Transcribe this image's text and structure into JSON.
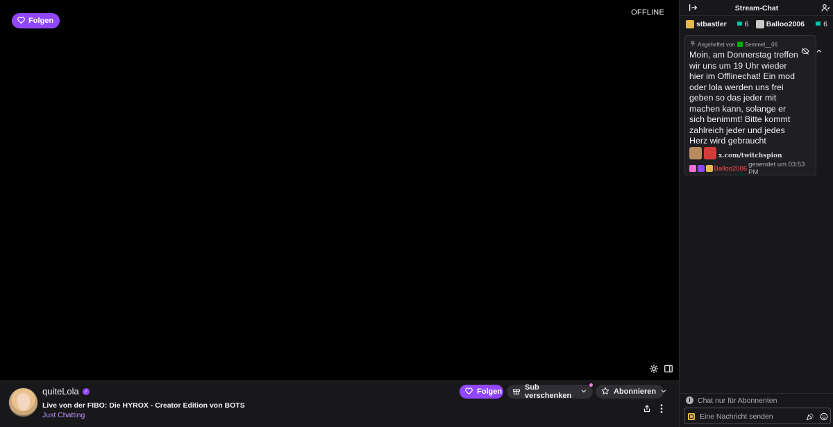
{
  "player": {
    "follow_label": "Folgen",
    "status": "OFFLINE"
  },
  "channel": {
    "name": "quiteLola",
    "title": "Live von der FIBO: Die HYROX - Creator Edition von BOTS",
    "category": "Just Chatting"
  },
  "actions": {
    "follow_label": "Folgen",
    "gift_sub_label": "Sub verschenken",
    "subscribe_label": "Abonnieren"
  },
  "chat": {
    "title": "Stream-Chat",
    "gifters": [
      {
        "name": "stbastler",
        "count": "6"
      },
      {
        "name": "Balloo2006",
        "count": "6"
      }
    ],
    "pinned": {
      "pinned_by_prefix": "Angeheftet von",
      "pinned_by": "Semmel__06",
      "message": "Moin, am Donnerstag treffen wir uns um 19 Uhr wieder hier im Offlinechat! Ein mod oder lola werden uns frei geben so das jeder mit machen kann, solange er sich benimmt! Bitte kommt zahlreich jeder und jedes Herz wird gebraucht",
      "watermark": "x.com/twitchspion",
      "sender": "Balloo2006",
      "sent_text": "gesendet um 03:53 PM"
    },
    "sub_only_notice": "Chat nur für Abonnenten",
    "input_placeholder": "Eine Nachricht senden"
  },
  "colors": {
    "accent": "#9147ff",
    "background": "#0e0e10",
    "panel": "#18181b"
  }
}
